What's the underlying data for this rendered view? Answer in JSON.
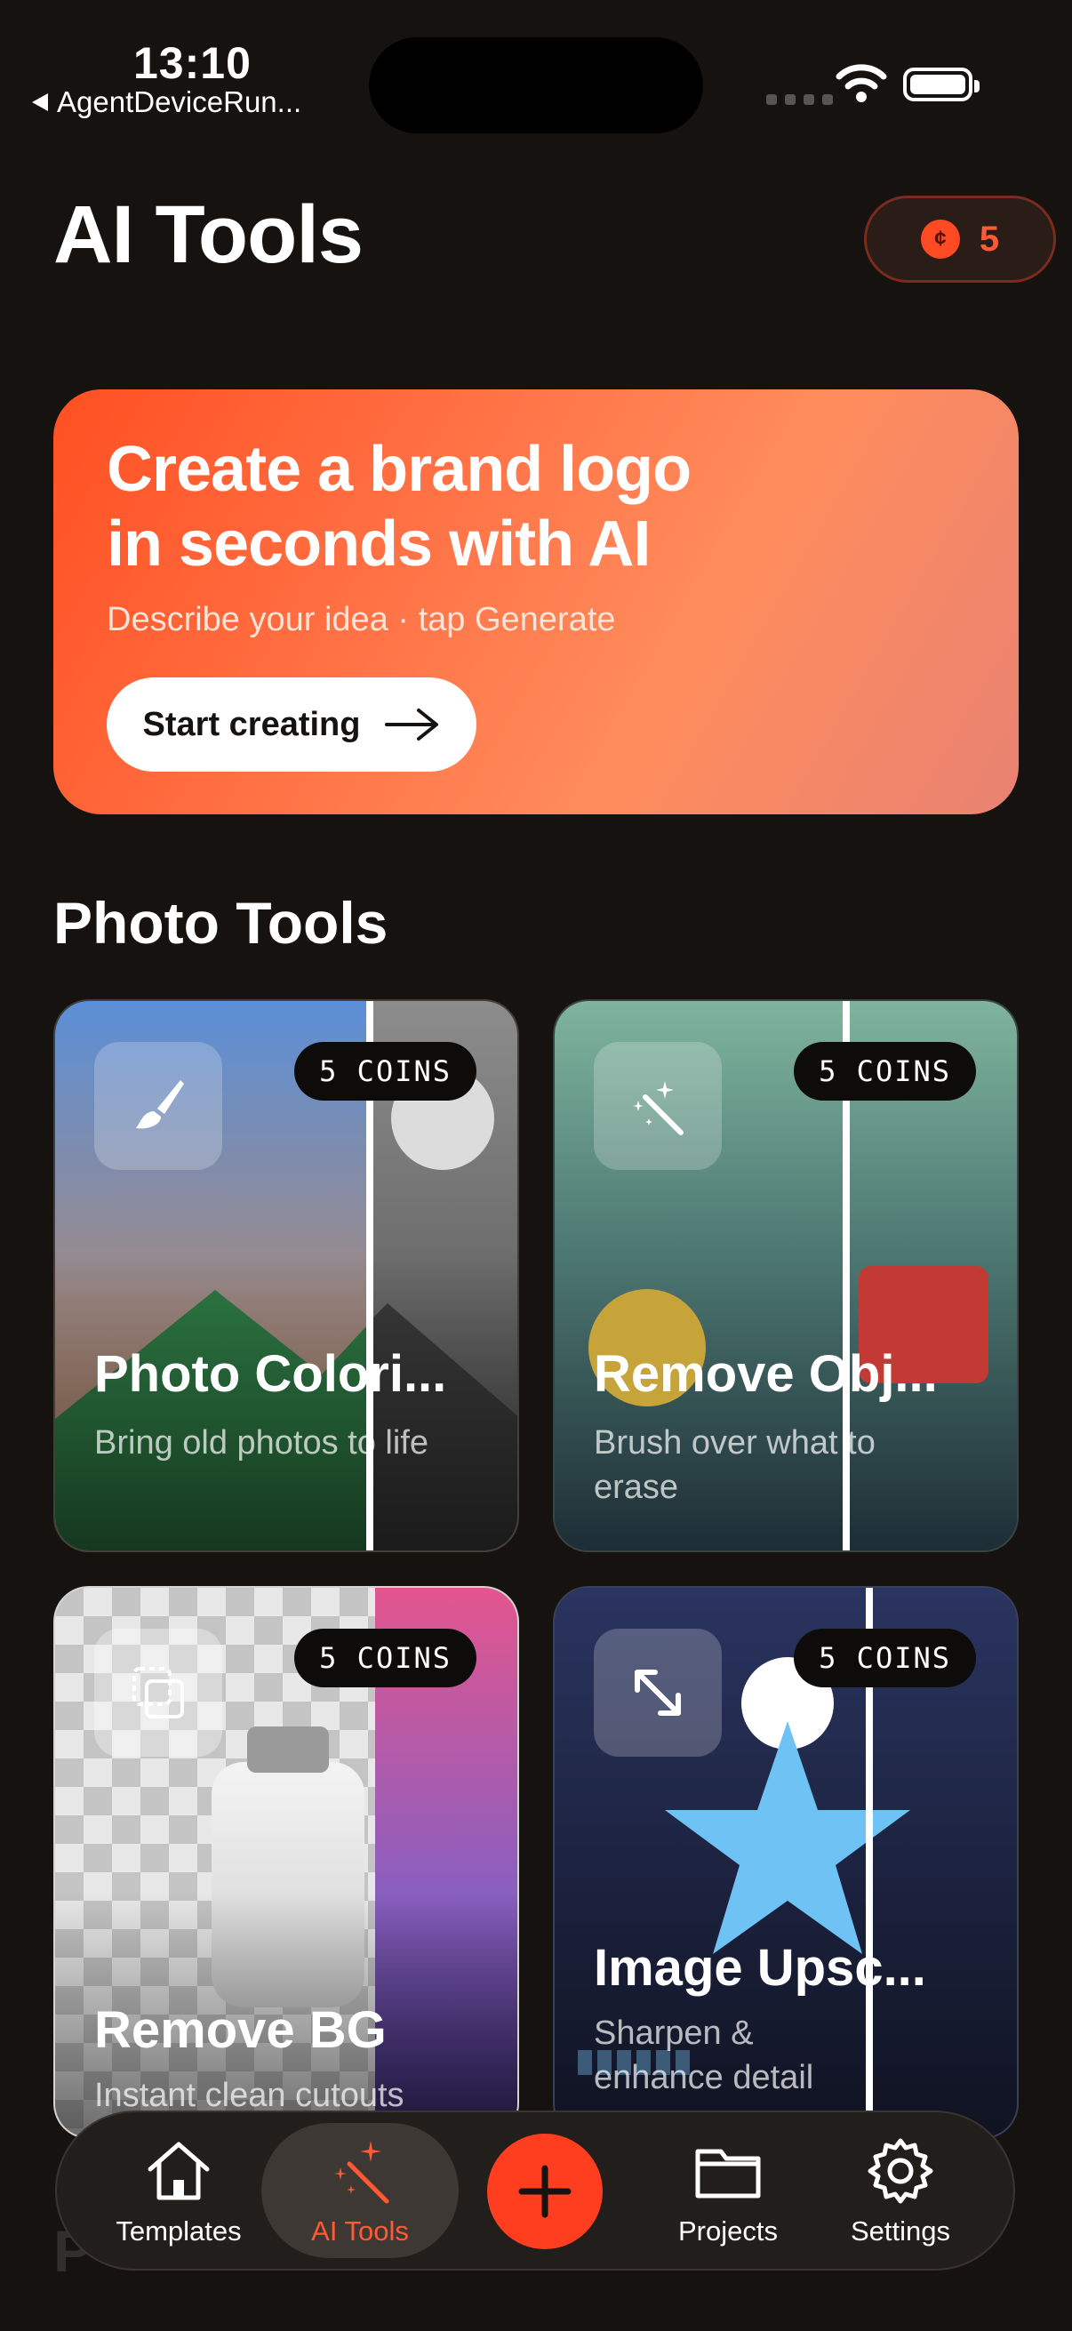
{
  "status_bar": {
    "time": "13:10",
    "back_app": "AgentDeviceRun..."
  },
  "header": {
    "title": "AI Tools",
    "coin_symbol": "¢",
    "coins": "5"
  },
  "banner": {
    "title_line1": "Create a brand logo",
    "title_line2": "in seconds with AI",
    "subtitle": "Describe your idea · tap Generate",
    "cta": "Start creating"
  },
  "section": {
    "title": "Photo Tools",
    "next_title_partial": "P"
  },
  "tools": [
    {
      "title": "Photo Colori...",
      "description": "Bring old photos to life",
      "badge": "5 COINS",
      "icon": "paintbrush-icon"
    },
    {
      "title": "Remove Obj...",
      "description": "Brush over what to erase",
      "badge": "5 COINS",
      "icon": "magic-wand-icon"
    },
    {
      "title": "Remove BG",
      "description": "Instant clean cutouts",
      "badge": "5 COINS",
      "icon": "layers-cutout-icon"
    },
    {
      "title": "Image Upsc...",
      "description": "Sharpen & enhance detail",
      "badge": "5 COINS",
      "icon": "expand-arrows-icon"
    }
  ],
  "tabbar": {
    "items": [
      {
        "label": "Templates",
        "icon": "home-icon"
      },
      {
        "label": "AI Tools",
        "icon": "magic-wand-icon",
        "active": true
      },
      {
        "label": "Projects",
        "icon": "folder-icon"
      },
      {
        "label": "Settings",
        "icon": "gear-icon"
      }
    ],
    "fab_icon": "plus-icon"
  },
  "colors": {
    "accent": "#ff4a24",
    "background": "#15120f"
  }
}
